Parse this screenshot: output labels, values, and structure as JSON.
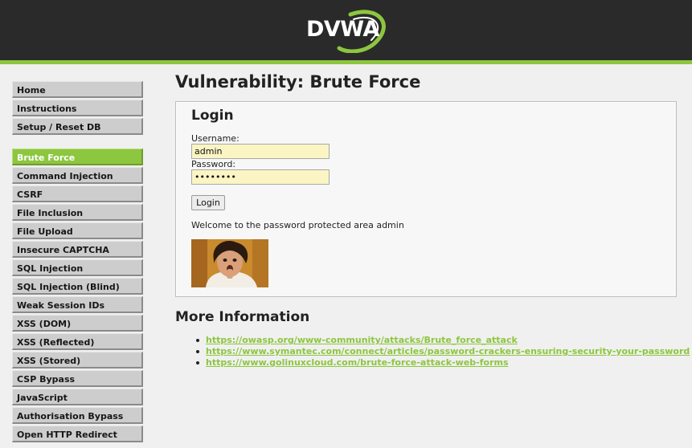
{
  "header": {
    "logo_text": "DVWA",
    "colors": {
      "background": "#2a2a2a",
      "accent": "#8dc63f"
    }
  },
  "sidebar": {
    "groups": [
      [
        "Home",
        "Instructions",
        "Setup / Reset DB"
      ],
      [
        "Brute Force",
        "Command Injection",
        "CSRF",
        "File Inclusion",
        "File Upload",
        "Insecure CAPTCHA",
        "SQL Injection",
        "SQL Injection (Blind)",
        "Weak Session IDs",
        "XSS (DOM)",
        "XSS (Reflected)",
        "XSS (Stored)",
        "CSP Bypass",
        "JavaScript",
        "Authorisation Bypass",
        "Open HTTP Redirect"
      ]
    ],
    "selected": "Brute Force"
  },
  "main": {
    "title": "Vulnerability: Brute Force",
    "login": {
      "heading": "Login",
      "username_label": "Username:",
      "username_value": "admin",
      "password_label": "Password:",
      "password_value": "********",
      "button_label": "Login",
      "welcome_text": "Welcome to the password protected area admin",
      "image": "user-photo"
    },
    "more_info": {
      "heading": "More Information",
      "links": [
        "https://owasp.org/www-community/attacks/Brute_force_attack",
        "https://www.symantec.com/connect/articles/password-crackers-ensuring-security-your-password",
        "https://www.golinuxcloud.com/brute-force-attack-web-forms"
      ]
    }
  }
}
